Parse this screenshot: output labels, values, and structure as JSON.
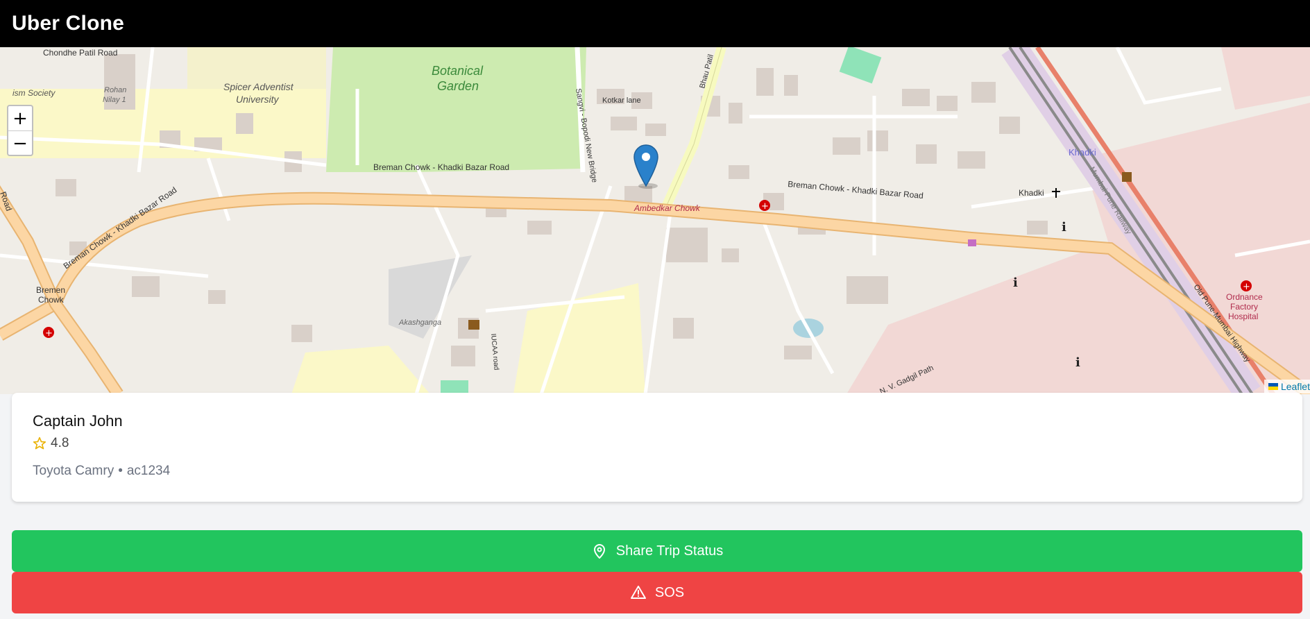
{
  "app": {
    "title": "Uber Clone"
  },
  "map": {
    "zoom_in": "+",
    "zoom_out": "−",
    "attribution": "Leaflet",
    "labels": {
      "road_top": "Chondhe Patil Road",
      "spicer": "Spicer Adventist University",
      "spicer_1": "Spicer Adventist",
      "spicer_2": "University",
      "ism": "ism Society",
      "rohan_1": "Rohan",
      "rohan_2": "Nilay 1",
      "botanical_1": "Botanical",
      "botanical_2": "Garden",
      "kotkar": "Kotkar lane",
      "sangvi": "Sangvi - Bopodi New Bridge",
      "bhau": "Bhau Patil",
      "breman_main": "Breman Chowk - Khadki Bazar Road",
      "ambedkar": "Ambedkar Chowk",
      "khadki": "Khadki",
      "khadki_station": "Khadki",
      "bremen_1": "Bremen",
      "bremen_2": "Chowk",
      "akashganga": "Akashganga",
      "iucaa": "IUCAA road",
      "railway": "Mumbai-Pune Railway",
      "ordnance_1": "Ordnance",
      "ordnance_2": "Factory",
      "ordnance_3": "Hospital",
      "old_pune": "Old Pune-Mumbai Highway",
      "gadgil": "N. V. Gadgil Path",
      "road_left": "Road"
    }
  },
  "driver": {
    "name": "Captain John",
    "rating": "4.8",
    "car": "Toyota Camry",
    "separator": "•",
    "plate": "ac1234"
  },
  "actions": {
    "share_label": "Share Trip Status",
    "sos_label": "SOS"
  },
  "colors": {
    "share": "#22c55e",
    "sos": "#ef4444",
    "header": "#000000",
    "marker": "#2a81cb"
  },
  "icons": [
    "map-pin-icon",
    "alert-triangle-icon",
    "star-icon",
    "map-marker-icon"
  ]
}
